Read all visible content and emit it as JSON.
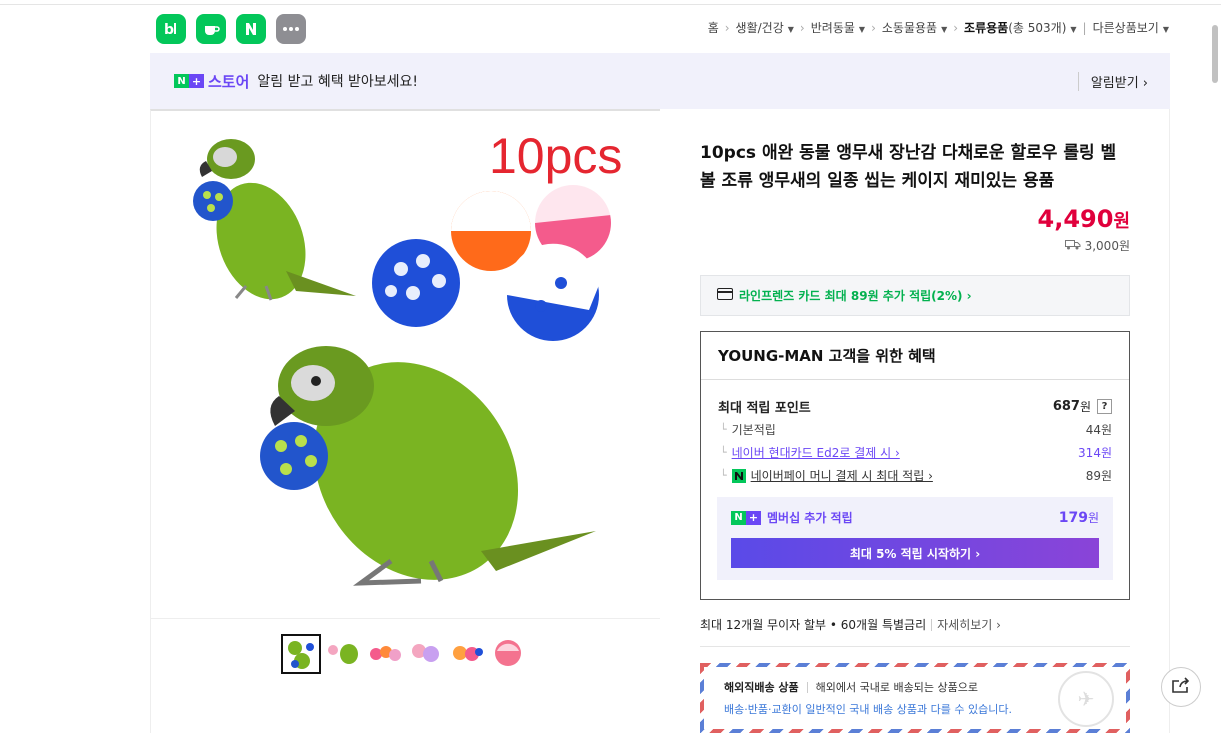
{
  "breadcrumb": [
    {
      "label": "홈",
      "dropdown": false
    },
    {
      "label": "생활/건강",
      "dropdown": true
    },
    {
      "label": "반려동물",
      "dropdown": true
    },
    {
      "label": "소동물용품",
      "dropdown": true
    },
    {
      "label": "조류용품",
      "count": "(총 503개)",
      "dropdown": true,
      "strong": true
    }
  ],
  "other_products": "다른상품보기",
  "banner": {
    "badge_n": "N",
    "badge_plus": "+",
    "store": "스토어",
    "message": "알림 받고 혜택 받아보세요!",
    "alarm_button": "알림받기 ›"
  },
  "product": {
    "image_text": "10pcs",
    "title": "10pcs 애완 동물 앵무새 장난감 다채로운 할로우 롤링 벨 볼 조류 앵무새의 일종 씹는 케이지 재미있는 용품",
    "price": "4,490",
    "price_unit": "원",
    "shipping": "3,000원",
    "card_benefit": "라인프렌즈 카드 최대 89원 추가 적립(2%) ›"
  },
  "benefit": {
    "title": "YOUNG-MAN 고객을 위한 혜택",
    "max_points_label": "최대 적립 포인트",
    "max_points_value": "687",
    "max_points_unit": "원",
    "help": "?",
    "rows": [
      {
        "label": "기본적립",
        "value": "44원"
      },
      {
        "label": "네이버 현대카드 Ed2로 결제 시 ›",
        "value": "314원"
      },
      {
        "label": "네이버페이 머니 결제 시 최대 적립 ›",
        "value": "89원"
      }
    ],
    "member_label": "멤버십 추가 적립",
    "member_value": "179",
    "member_unit": "원",
    "member_button": "최대 5% 적립 시작하기 ›"
  },
  "installment": {
    "text": "최대 12개월 무이자 할부 • 60개월 특별금리",
    "more": "자세히보기 ›"
  },
  "overseas": {
    "title": "해외직배송 상품",
    "desc": "해외에서 국내로 배송되는 상품으로",
    "notice": "배송·반품·교환이 일반적인 국내 배송 상품과 다를 수 있습니다."
  },
  "colors": {
    "naver_green": "#03c75a",
    "brand_purple": "#6b47f5",
    "price_red": "#e0003c"
  }
}
